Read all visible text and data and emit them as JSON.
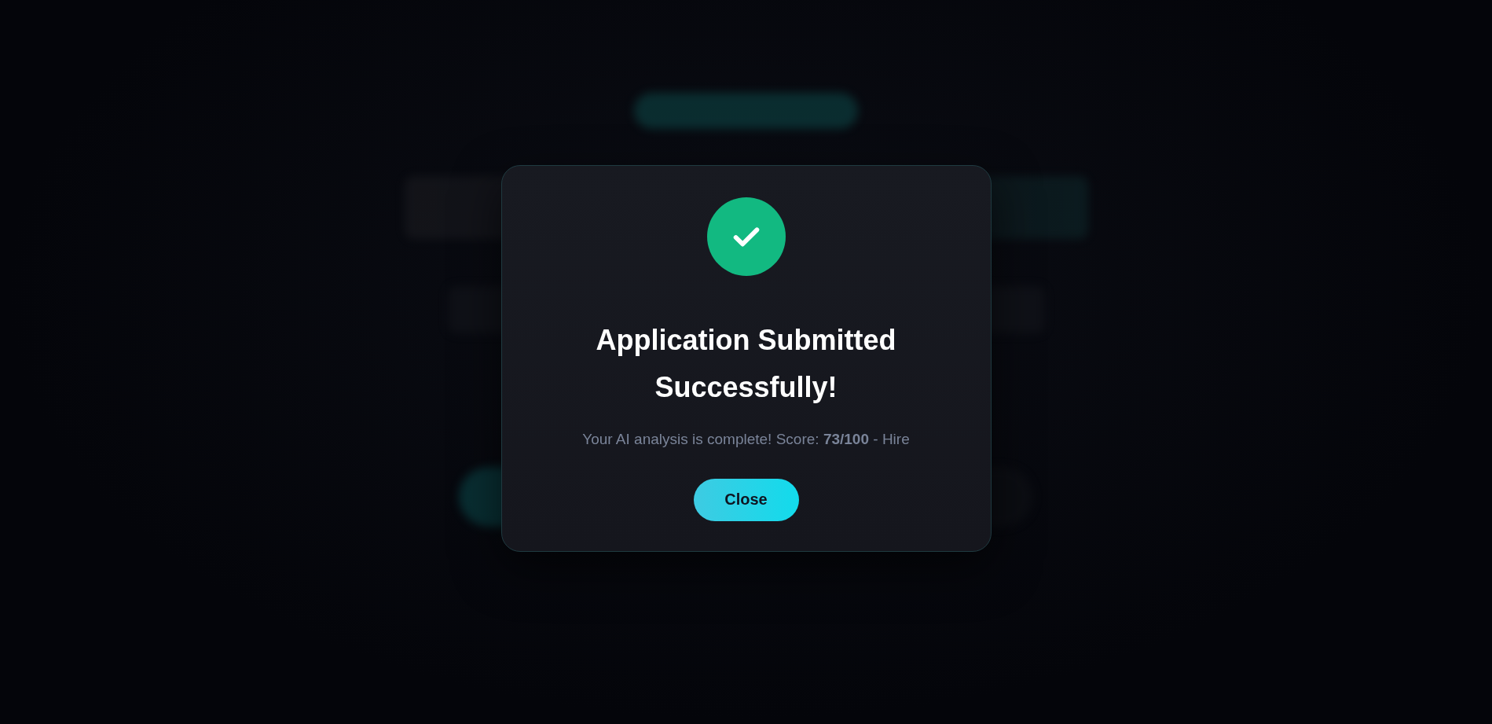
{
  "dialog": {
    "title": "Application Submitted Successfully!",
    "message": "Your AI analysis is complete! Score: **73/100** - Hire",
    "buttons": [
      "Close"
    ]
  }
}
